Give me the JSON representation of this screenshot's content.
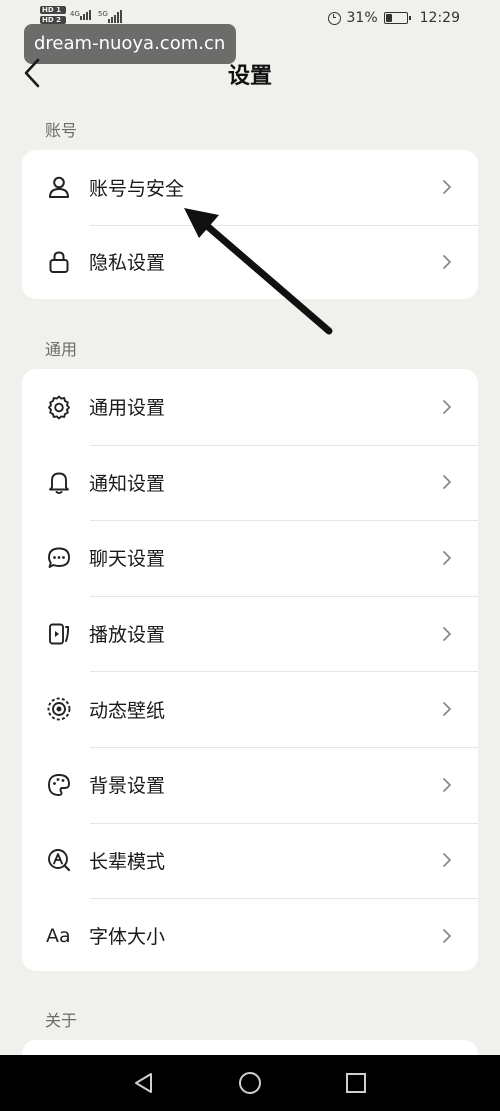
{
  "status_bar": {
    "hd1": "HD 1",
    "hd2": "HD 2",
    "net1": "4G",
    "net2": "5G",
    "battery_percent": "31%",
    "battery_level": 0.31,
    "time": "12:29"
  },
  "watermark": "dream-nuoya.com.cn",
  "header": {
    "title": "设置"
  },
  "sections": {
    "account": {
      "label": "账号",
      "items": [
        {
          "label": "账号与安全",
          "icon": "person-icon"
        },
        {
          "label": "隐私设置",
          "icon": "lock-icon"
        }
      ]
    },
    "general": {
      "label": "通用",
      "items": [
        {
          "label": "通用设置",
          "icon": "gear-icon"
        },
        {
          "label": "通知设置",
          "icon": "bell-icon"
        },
        {
          "label": "聊天设置",
          "icon": "chat-bubble-icon"
        },
        {
          "label": "播放设置",
          "icon": "play-icon"
        },
        {
          "label": "动态壁纸",
          "icon": "live-wallpaper-icon"
        },
        {
          "label": "背景设置",
          "icon": "palette-icon"
        },
        {
          "label": "长辈模式",
          "icon": "elder-mode-icon"
        },
        {
          "label": "字体大小",
          "icon": "font-size-icon",
          "icon_text": "Aa"
        }
      ]
    },
    "about": {
      "label": "关于"
    }
  },
  "colors": {
    "background": "#f0f0ec",
    "card": "#ffffff",
    "text": "#1a1a1a",
    "section_label": "#6b6b6b",
    "nav_bar": "#000000"
  }
}
